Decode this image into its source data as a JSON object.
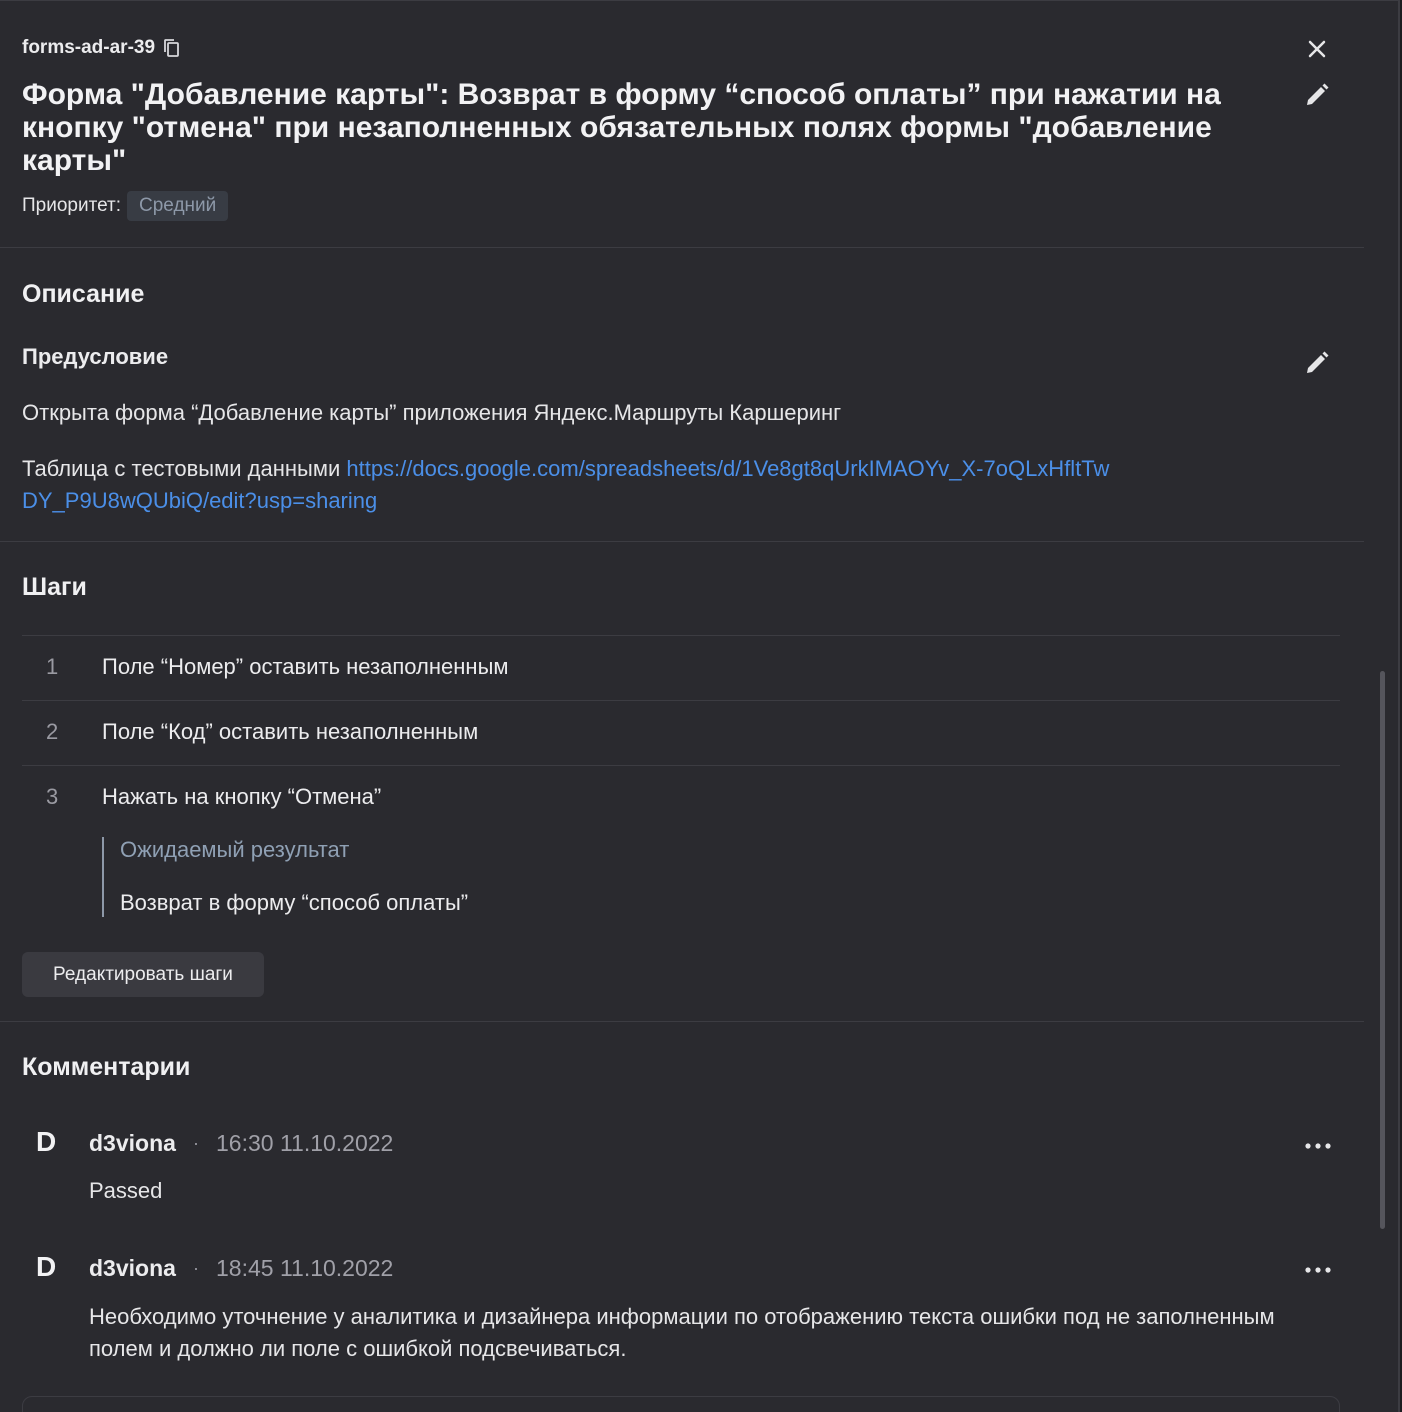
{
  "header": {
    "case_id": "forms-ad-ar-39",
    "title": "Форма \"Добавление карты\": Возврат в форму “способ оплаты” при нажатии на кнопку \"отмена\" при незаполненных обязательных полях формы \"добавление карты\"",
    "priority_label": "Приоритет:",
    "priority_value": "Средний",
    "icons": {
      "copy": "copy-icon",
      "close": "close-icon",
      "edit": "pencil-icon"
    }
  },
  "description": {
    "heading": "Описание",
    "precondition_heading": "Предусловие",
    "precondition_text": "Открыта форма “Добавление карты” приложения Яндекс.Маршруты Каршеринг",
    "table_label": "Таблица с тестовыми данными ",
    "table_link": "https://docs.google.com/spreadsheets/d/1Ve8gt8qUrkIMAOYv_X-7oQLxHfltTwDY_P9U8wQUbiQ/edit?usp=sharing"
  },
  "steps": {
    "heading": "Шаги",
    "items": [
      {
        "num": "1",
        "text": "Поле “Номер” оставить незаполненным"
      },
      {
        "num": "2",
        "text": "Поле “Код” оставить незаполненным"
      },
      {
        "num": "3",
        "text": "Нажать на кнопку “Отмена”"
      }
    ],
    "expected_label": "Ожидаемый результат",
    "expected_value": "Возврат в форму “способ оплаты”",
    "edit_button": "Редактировать шаги"
  },
  "comments": {
    "heading": "Комментарии",
    "items": [
      {
        "avatar": "D",
        "author": "d3viona",
        "separator": "·",
        "time": "16:30 11.10.2022",
        "text": "Passed"
      },
      {
        "avatar": "D",
        "author": "d3viona",
        "separator": "·",
        "time": "18:45 11.10.2022",
        "text": "Необходимо уточнение у аналитика и дизайнера информации по отображению текста ошибки под не заполненным полем и должно ли поле с ошибкой подсвечиваться."
      }
    ]
  },
  "colors": {
    "background": "#2a2a2f",
    "link": "#4b8fe8",
    "badge_bg": "#383c44",
    "badge_text": "#8d98a8"
  }
}
